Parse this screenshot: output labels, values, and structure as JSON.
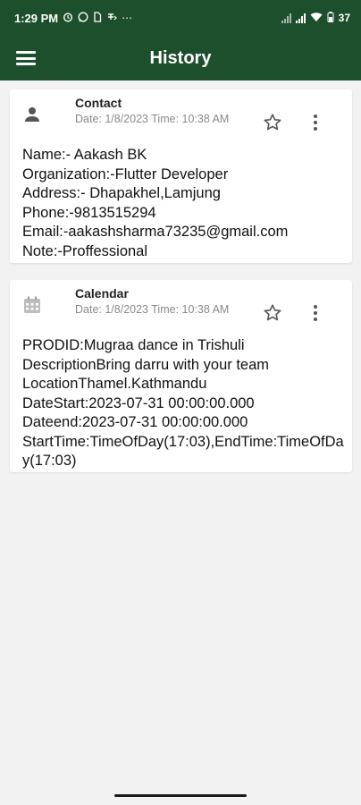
{
  "status_bar": {
    "time": "1:29 PM",
    "left_icons": [
      "alarm-icon",
      "whatsapp-icon",
      "sim-icon",
      "network-icon"
    ],
    "more_indicator": "⋯",
    "battery": "37"
  },
  "app_bar": {
    "title": "History",
    "menu_icon": "hamburger-menu-icon"
  },
  "history": [
    {
      "type_icon": "person-icon",
      "title": "Contact",
      "date": "Date: 1/8/2023 Time: 10:38 AM",
      "lines": [
        "Name:- Aakash BK",
        "Organization:-Flutter Developer",
        "Address:- Dhapakhel,Lamjung",
        "Phone:-9813515294",
        "Email:-aakashsharma73235@gmail.com",
        "Note:-Proffessional"
      ]
    },
    {
      "type_icon": "calendar-icon",
      "title": "Calendar",
      "date": "Date: 1/8/2023 Time: 10:38 AM",
      "lines": [
        "PRODID:Mugraa dance in Trishuli",
        "DescriptionBring darru with your team",
        "LocationThamel.Kathmandu",
        "DateStart:2023-07-31 00:00:00.000",
        "Dateend:2023-07-31 00:00:00.000",
        "StartTime:TimeOfDay(17:03),EndTime:TimeOfDay(17:03)"
      ]
    }
  ],
  "colors": {
    "app_bar": "#1d4f2d",
    "background": "#f2f2f2",
    "card": "#ffffff",
    "date_text": "#8a8a8a"
  }
}
